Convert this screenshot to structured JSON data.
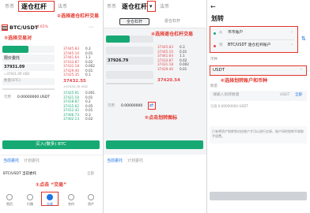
{
  "panel1": {
    "tabs": [
      "币币",
      "逐仓杠杆",
      "法币"
    ],
    "pair": "BTC/USDT",
    "change": "-4.65%",
    "buy_label": "买入",
    "sell_label": "卖出",
    "order_type": "限价委托",
    "price": "37931.09",
    "price_sub": "≈37931.09 USD",
    "amount_label": "数量(BTC)",
    "balance_label": "可用",
    "balance_value": "0.00000000 USDT",
    "asks": [
      {
        "p": "37445.83",
        "q": "0.3"
      },
      {
        "p": "37445.10",
        "q": "0.01"
      },
      {
        "p": "37441.64",
        "q": "1.1"
      },
      {
        "p": "37433.87",
        "q": "0.02"
      },
      {
        "p": "37431.18",
        "q": "0.002"
      },
      {
        "p": "37429.40",
        "q": "0.01"
      },
      {
        "p": "37425.35",
        "q": "0.1"
      }
    ],
    "last_price": "37432.55",
    "last_sub": "≈37432.55 USD",
    "bids": [
      {
        "p": "37425.91",
        "q": "0.001"
      },
      {
        "p": "37421.10",
        "q": "0.01"
      },
      {
        "p": "37418.87",
        "q": "0.2"
      },
      {
        "p": "37415.62",
        "q": "0.05"
      },
      {
        "p": "37412.42",
        "q": "0.01"
      },
      {
        "p": "37406.73",
        "q": "0.3"
      },
      {
        "p": "37402.13",
        "q": "0.02"
      }
    ],
    "buy_button": "买入(做多) BTC",
    "orders_tabs": [
      "当前委托",
      "计划委托"
    ],
    "orders_title": "BTC/USDT 当前委托",
    "orders_more": "全部",
    "nav": [
      "首页",
      "行情",
      "交易",
      "合约",
      "资产"
    ],
    "annotation_tab": "②选择逐仓杠杆交易",
    "annotation_pair": "③选择交易对",
    "annotation_nav_prefix": "①点击",
    "annotation_nav_quote": "“交易”"
  },
  "panel2": {
    "tabs": [
      "币币",
      "逐仓杠杆",
      "法币"
    ],
    "dropdown_arrow": "▾",
    "mode_tabs": [
      "全仓杠杆",
      "逐仓杠杆"
    ],
    "buy_label": "买入",
    "sell_label": "卖出",
    "price": "37926.79",
    "balance_label": "可用",
    "balance_value": "0.00000000",
    "last_price": "37420.54",
    "orders_tabs": [
      "当前委托",
      "计划委托"
    ],
    "annotation_top": "④选择逐仓杠杆交易",
    "annotation_transfer": "⑤点击划转图标"
  },
  "panel3": {
    "back": "←",
    "title": "划转",
    "from_label": "从",
    "from_value": "币币账户",
    "to_label": "到",
    "to_value": "BTC/USDT 逐仓杠杆账户",
    "swap_icon": "⇅",
    "coin_label": "币种",
    "coin_value": "USDT",
    "amount_label": "数量",
    "amount_placeholder": "请输入划转数量",
    "amount_unit": "USDT",
    "amount_all": "全部",
    "available": "可用 0.00000000 USDT",
    "notice": "只有将资产划转到对应账户才可以进行交易，账户间的划转不收取手续费。",
    "annotation": "⑥选择划转账户和币种"
  },
  "colors": {
    "accent_red": "#e5332a",
    "buy_green": "#17a974",
    "sell_red": "#e5484d"
  }
}
